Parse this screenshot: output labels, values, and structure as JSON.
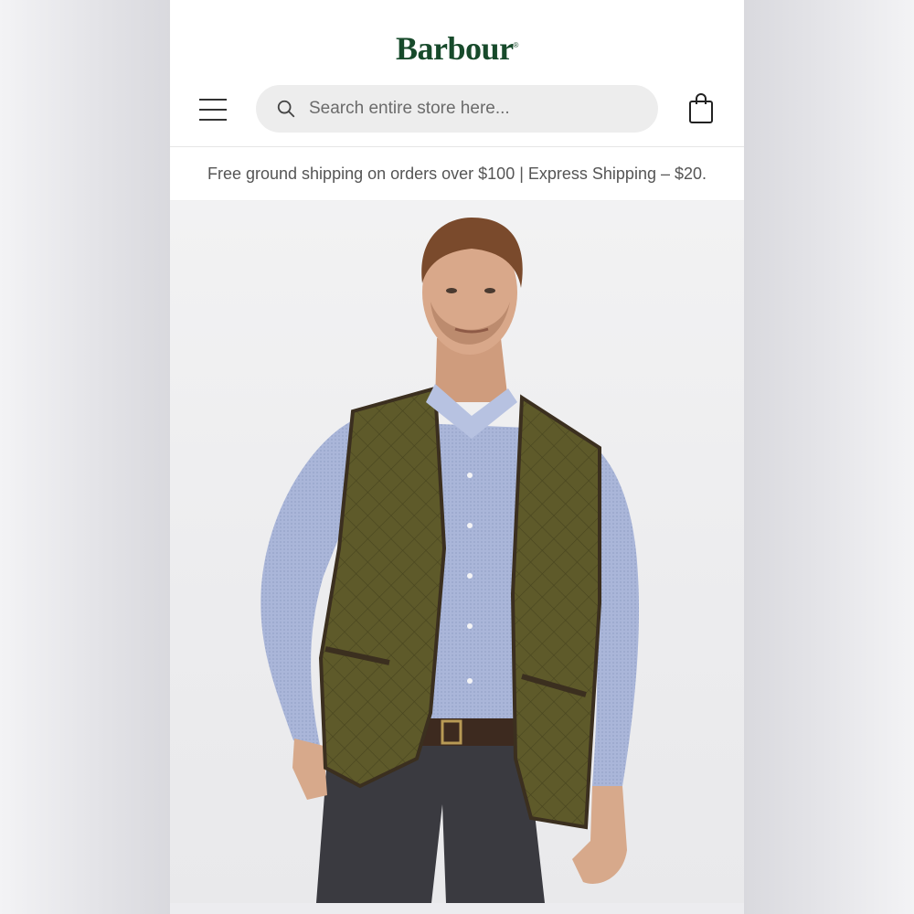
{
  "brand": {
    "name": "Barbour"
  },
  "search": {
    "placeholder": "Search entire store here..."
  },
  "promo": {
    "text": "Free ground shipping on orders over $100 | Express Shipping – $20."
  },
  "colors": {
    "brand_green": "#174a2b",
    "vest_olive": "#5e5a2a",
    "shirt_blue": "#a9b6d8",
    "trousers": "#3a3a40"
  },
  "icons": {
    "menu": "menu-icon",
    "search": "search-icon",
    "bag": "shopping-bag-icon"
  },
  "hero": {
    "image": "model-wearing-quilted-olive-vest"
  }
}
